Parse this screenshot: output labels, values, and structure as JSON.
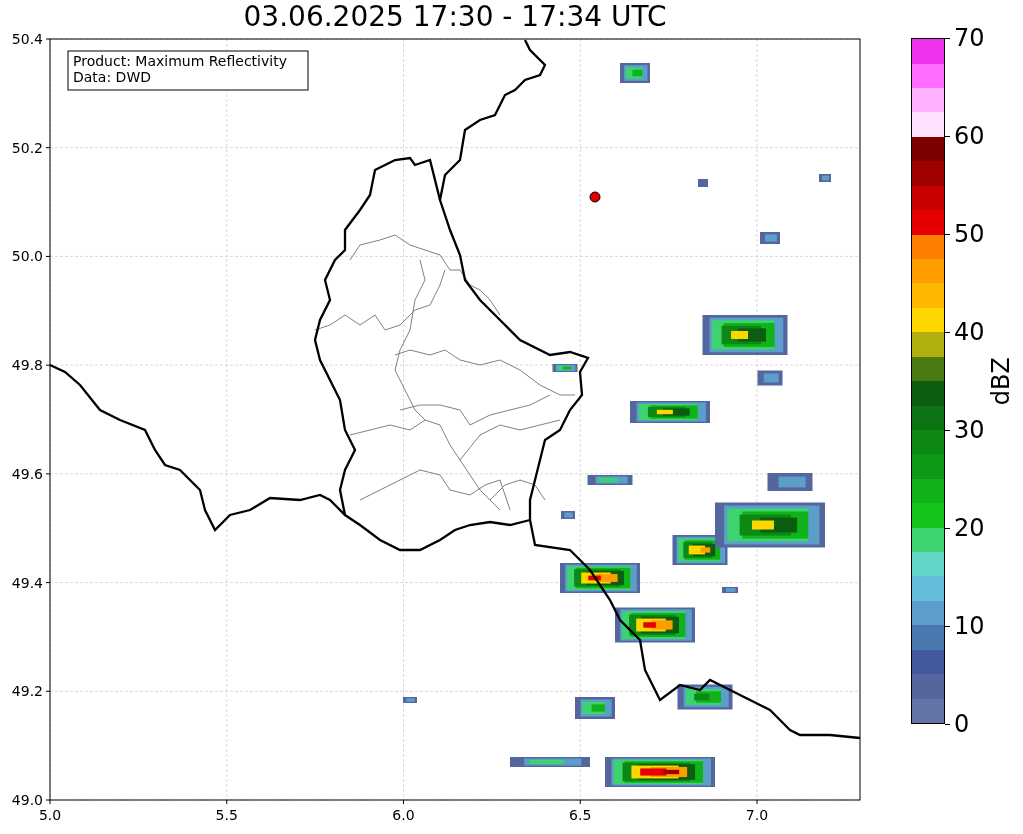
{
  "title": "03.06.2025 17:30 - 17:34 UTC",
  "info_box": {
    "lines": [
      "Product: Maximum Reflectivity",
      "Data: DWD"
    ]
  },
  "axes": {
    "x_ticks": [
      "5.0",
      "5.5",
      "6.0",
      "6.5",
      "7.0"
    ],
    "y_ticks": [
      "50.4",
      "50.2",
      "50.0",
      "49.8",
      "49.6",
      "49.4",
      "49.2",
      "49.0"
    ]
  },
  "colorbar": {
    "label": "dBZ",
    "ticks": [
      "70",
      "60",
      "50",
      "40",
      "30",
      "20",
      "10",
      "0"
    ],
    "bins": [
      {
        "color": "#6274a6"
      },
      {
        "color": "#55669f"
      },
      {
        "color": "#44589f"
      },
      {
        "color": "#4a78b0"
      },
      {
        "color": "#5b9ec9"
      },
      {
        "color": "#63bcd9"
      },
      {
        "color": "#60d6c6"
      },
      {
        "color": "#3dd46f"
      },
      {
        "color": "#14c61c"
      },
      {
        "color": "#10b41a"
      },
      {
        "color": "#0e9a16"
      },
      {
        "color": "#0d8813"
      },
      {
        "color": "#0c7414"
      },
      {
        "color": "#0b5e10"
      },
      {
        "color": "#4a7a12"
      },
      {
        "color": "#b0b010"
      },
      {
        "color": "#ffd700"
      },
      {
        "color": "#ffb800"
      },
      {
        "color": "#ff9c00"
      },
      {
        "color": "#ff7e00"
      },
      {
        "color": "#e60000"
      },
      {
        "color": "#c80000"
      },
      {
        "color": "#a00000"
      },
      {
        "color": "#7d0000"
      },
      {
        "color": "#ffe0ff"
      },
      {
        "color": "#ffb0ff"
      },
      {
        "color": "#ff6cff"
      },
      {
        "color": "#ee33ee"
      }
    ]
  }
}
